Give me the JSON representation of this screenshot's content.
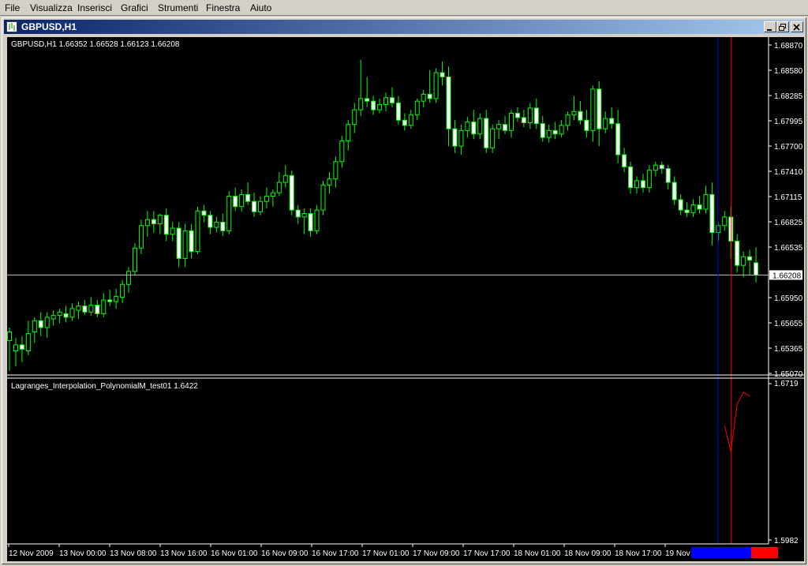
{
  "menu": [
    "File",
    "Visualizza",
    "Inserisci",
    "Grafici",
    "Strumenti",
    "Finestra",
    "Aiuto"
  ],
  "window": {
    "title": "GBPUSD,H1"
  },
  "main_chart": {
    "info": "GBPUSD,H1  1.66352 1.66528 1.66123 1.66208",
    "price_ticks": [
      "1.68870",
      "1.68580",
      "1.68285",
      "1.67995",
      "1.67700",
      "1.67410",
      "1.67115",
      "1.66825",
      "1.66535",
      "1.65950",
      "1.65655",
      "1.65365",
      "1.65070"
    ],
    "current_price": "1.66208",
    "ylim": [
      1.6507,
      1.6887
    ],
    "bull_color": "#00ff00",
    "bear_color": "#ffffff",
    "hline_color": "#c0c0c0"
  },
  "indicator": {
    "label": "Lagranges_Interpolation_PolynomialM_test01 1.6422",
    "top_value": "1.6719",
    "bottom_value": "1.5982",
    "line_color": "#ff0000"
  },
  "time_axis": {
    "labels": [
      "12 Nov 2009",
      "13 Nov 00:00",
      "13 Nov 08:00",
      "13 Nov 16:00",
      "16 Nov 01:00",
      "16 Nov 09:00",
      "16 Nov 17:00",
      "17 Nov 01:00",
      "17 Nov 09:00",
      "17 Nov 17:00",
      "18 Nov 01:00",
      "18 Nov 09:00",
      "18 Nov 17:00",
      "19 Nov"
    ],
    "blue_marker_color": "#0000ff",
    "red_marker_color": "#ff0000"
  },
  "chart_data": {
    "type": "candlestick",
    "ylim": [
      1.6507,
      1.6887
    ],
    "candles": [
      {
        "o": 1.6545,
        "h": 1.656,
        "l": 1.651,
        "c": 1.6555
      },
      {
        "o": 1.6533,
        "h": 1.6548,
        "l": 1.6515,
        "c": 1.654
      },
      {
        "o": 1.654,
        "h": 1.655,
        "l": 1.652,
        "c": 1.6535
      },
      {
        "o": 1.6533,
        "h": 1.6568,
        "l": 1.6528,
        "c": 1.6553
      },
      {
        "o": 1.6555,
        "h": 1.6572,
        "l": 1.6542,
        "c": 1.6568
      },
      {
        "o": 1.6568,
        "h": 1.6578,
        "l": 1.655,
        "c": 1.656
      },
      {
        "o": 1.656,
        "h": 1.6578,
        "l": 1.6548,
        "c": 1.6572
      },
      {
        "o": 1.657,
        "h": 1.658,
        "l": 1.6562,
        "c": 1.6574
      },
      {
        "o": 1.6574,
        "h": 1.6582,
        "l": 1.6565,
        "c": 1.6578
      },
      {
        "o": 1.6576,
        "h": 1.6585,
        "l": 1.6566,
        "c": 1.6572
      },
      {
        "o": 1.6572,
        "h": 1.6588,
        "l": 1.6568,
        "c": 1.6582
      },
      {
        "o": 1.658,
        "h": 1.659,
        "l": 1.657,
        "c": 1.6585
      },
      {
        "o": 1.6585,
        "h": 1.6592,
        "l": 1.6575,
        "c": 1.6578
      },
      {
        "o": 1.6578,
        "h": 1.6595,
        "l": 1.6574,
        "c": 1.6586
      },
      {
        "o": 1.6586,
        "h": 1.6592,
        "l": 1.6572,
        "c": 1.6576
      },
      {
        "o": 1.6576,
        "h": 1.66,
        "l": 1.6572,
        "c": 1.6592
      },
      {
        "o": 1.6592,
        "h": 1.6604,
        "l": 1.6585,
        "c": 1.659
      },
      {
        "o": 1.659,
        "h": 1.6605,
        "l": 1.6582,
        "c": 1.6596
      },
      {
        "o": 1.6595,
        "h": 1.6615,
        "l": 1.6588,
        "c": 1.661
      },
      {
        "o": 1.661,
        "h": 1.663,
        "l": 1.66,
        "c": 1.6625
      },
      {
        "o": 1.6625,
        "h": 1.6658,
        "l": 1.662,
        "c": 1.6652
      },
      {
        "o": 1.6652,
        "h": 1.6685,
        "l": 1.6645,
        "c": 1.6678
      },
      {
        "o": 1.6678,
        "h": 1.6695,
        "l": 1.6665,
        "c": 1.6685
      },
      {
        "o": 1.6685,
        "h": 1.6695,
        "l": 1.667,
        "c": 1.668
      },
      {
        "o": 1.668,
        "h": 1.6692,
        "l": 1.6668,
        "c": 1.669
      },
      {
        "o": 1.669,
        "h": 1.6698,
        "l": 1.666,
        "c": 1.6668
      },
      {
        "o": 1.6668,
        "h": 1.6682,
        "l": 1.666,
        "c": 1.6675
      },
      {
        "o": 1.6675,
        "h": 1.6682,
        "l": 1.663,
        "c": 1.664
      },
      {
        "o": 1.664,
        "h": 1.668,
        "l": 1.663,
        "c": 1.6672
      },
      {
        "o": 1.6672,
        "h": 1.668,
        "l": 1.664,
        "c": 1.6648
      },
      {
        "o": 1.6648,
        "h": 1.67,
        "l": 1.6645,
        "c": 1.6695
      },
      {
        "o": 1.6695,
        "h": 1.6702,
        "l": 1.6682,
        "c": 1.669
      },
      {
        "o": 1.669,
        "h": 1.6695,
        "l": 1.6668,
        "c": 1.6676
      },
      {
        "o": 1.6676,
        "h": 1.6688,
        "l": 1.667,
        "c": 1.6682
      },
      {
        "o": 1.6682,
        "h": 1.6692,
        "l": 1.6666,
        "c": 1.6672
      },
      {
        "o": 1.6672,
        "h": 1.6718,
        "l": 1.6668,
        "c": 1.6712
      },
      {
        "o": 1.6712,
        "h": 1.6722,
        "l": 1.6695,
        "c": 1.67
      },
      {
        "o": 1.67,
        "h": 1.672,
        "l": 1.6694,
        "c": 1.6714
      },
      {
        "o": 1.6714,
        "h": 1.6728,
        "l": 1.6702,
        "c": 1.6706
      },
      {
        "o": 1.6706,
        "h": 1.6716,
        "l": 1.6688,
        "c": 1.6694
      },
      {
        "o": 1.6694,
        "h": 1.6712,
        "l": 1.669,
        "c": 1.6706
      },
      {
        "o": 1.6706,
        "h": 1.6722,
        "l": 1.6698,
        "c": 1.6712
      },
      {
        "o": 1.6712,
        "h": 1.672,
        "l": 1.67,
        "c": 1.6716
      },
      {
        "o": 1.6716,
        "h": 1.674,
        "l": 1.6712,
        "c": 1.6728
      },
      {
        "o": 1.6728,
        "h": 1.6748,
        "l": 1.6722,
        "c": 1.6736
      },
      {
        "o": 1.6736,
        "h": 1.6742,
        "l": 1.669,
        "c": 1.6696
      },
      {
        "o": 1.6696,
        "h": 1.6702,
        "l": 1.668,
        "c": 1.6688
      },
      {
        "o": 1.6688,
        "h": 1.6698,
        "l": 1.6668,
        "c": 1.6692
      },
      {
        "o": 1.6692,
        "h": 1.6698,
        "l": 1.6665,
        "c": 1.6672
      },
      {
        "o": 1.6672,
        "h": 1.6702,
        "l": 1.6668,
        "c": 1.6696
      },
      {
        "o": 1.6696,
        "h": 1.673,
        "l": 1.669,
        "c": 1.6725
      },
      {
        "o": 1.6725,
        "h": 1.674,
        "l": 1.6715,
        "c": 1.6732
      },
      {
        "o": 1.6732,
        "h": 1.6758,
        "l": 1.6722,
        "c": 1.6752
      },
      {
        "o": 1.6752,
        "h": 1.6782,
        "l": 1.6745,
        "c": 1.6776
      },
      {
        "o": 1.6776,
        "h": 1.68,
        "l": 1.6765,
        "c": 1.6795
      },
      {
        "o": 1.6795,
        "h": 1.682,
        "l": 1.6785,
        "c": 1.6812
      },
      {
        "o": 1.6812,
        "h": 1.687,
        "l": 1.6805,
        "c": 1.6825
      },
      {
        "o": 1.6825,
        "h": 1.685,
        "l": 1.6815,
        "c": 1.6822
      },
      {
        "o": 1.6822,
        "h": 1.6828,
        "l": 1.6806,
        "c": 1.6812
      },
      {
        "o": 1.6812,
        "h": 1.6825,
        "l": 1.6808,
        "c": 1.6818
      },
      {
        "o": 1.6818,
        "h": 1.6832,
        "l": 1.681,
        "c": 1.6826
      },
      {
        "o": 1.6826,
        "h": 1.6838,
        "l": 1.6815,
        "c": 1.682
      },
      {
        "o": 1.682,
        "h": 1.6828,
        "l": 1.6795,
        "c": 1.68
      },
      {
        "o": 1.68,
        "h": 1.6808,
        "l": 1.6788,
        "c": 1.6794
      },
      {
        "o": 1.6794,
        "h": 1.6812,
        "l": 1.679,
        "c": 1.6806
      },
      {
        "o": 1.6806,
        "h": 1.6825,
        "l": 1.68,
        "c": 1.6822
      },
      {
        "o": 1.6822,
        "h": 1.6835,
        "l": 1.6815,
        "c": 1.683
      },
      {
        "o": 1.683,
        "h": 1.6858,
        "l": 1.682,
        "c": 1.6825
      },
      {
        "o": 1.6825,
        "h": 1.686,
        "l": 1.682,
        "c": 1.6855
      },
      {
        "o": 1.6855,
        "h": 1.6868,
        "l": 1.684,
        "c": 1.685
      },
      {
        "o": 1.685,
        "h": 1.6862,
        "l": 1.677,
        "c": 1.679
      },
      {
        "o": 1.679,
        "h": 1.68,
        "l": 1.6762,
        "c": 1.677
      },
      {
        "o": 1.677,
        "h": 1.6795,
        "l": 1.676,
        "c": 1.6788
      },
      {
        "o": 1.6788,
        "h": 1.6804,
        "l": 1.678,
        "c": 1.6798
      },
      {
        "o": 1.6798,
        "h": 1.6812,
        "l": 1.6778,
        "c": 1.6784
      },
      {
        "o": 1.6784,
        "h": 1.6808,
        "l": 1.6778,
        "c": 1.6802
      },
      {
        "o": 1.6802,
        "h": 1.6812,
        "l": 1.6762,
        "c": 1.6768
      },
      {
        "o": 1.6768,
        "h": 1.6795,
        "l": 1.6762,
        "c": 1.679
      },
      {
        "o": 1.679,
        "h": 1.68,
        "l": 1.6778,
        "c": 1.6795
      },
      {
        "o": 1.6795,
        "h": 1.6805,
        "l": 1.6784,
        "c": 1.6788
      },
      {
        "o": 1.6788,
        "h": 1.6812,
        "l": 1.678,
        "c": 1.6808
      },
      {
        "o": 1.6808,
        "h": 1.6815,
        "l": 1.6798,
        "c": 1.6803
      },
      {
        "o": 1.6803,
        "h": 1.6812,
        "l": 1.6792,
        "c": 1.6797
      },
      {
        "o": 1.6797,
        "h": 1.682,
        "l": 1.679,
        "c": 1.6814
      },
      {
        "o": 1.6814,
        "h": 1.6825,
        "l": 1.679,
        "c": 1.6796
      },
      {
        "o": 1.6796,
        "h": 1.6805,
        "l": 1.6775,
        "c": 1.678
      },
      {
        "o": 1.678,
        "h": 1.6795,
        "l": 1.6774,
        "c": 1.6788
      },
      {
        "o": 1.6788,
        "h": 1.6798,
        "l": 1.6778,
        "c": 1.6784
      },
      {
        "o": 1.6784,
        "h": 1.68,
        "l": 1.678,
        "c": 1.6794
      },
      {
        "o": 1.6794,
        "h": 1.681,
        "l": 1.6788,
        "c": 1.6806
      },
      {
        "o": 1.6806,
        "h": 1.6828,
        "l": 1.68,
        "c": 1.681
      },
      {
        "o": 1.681,
        "h": 1.6822,
        "l": 1.6795,
        "c": 1.68
      },
      {
        "o": 1.68,
        "h": 1.6812,
        "l": 1.678,
        "c": 1.6788
      },
      {
        "o": 1.6788,
        "h": 1.684,
        "l": 1.6775,
        "c": 1.6836
      },
      {
        "o": 1.6836,
        "h": 1.6845,
        "l": 1.677,
        "c": 1.679
      },
      {
        "o": 1.679,
        "h": 1.681,
        "l": 1.6785,
        "c": 1.6802
      },
      {
        "o": 1.6802,
        "h": 1.6815,
        "l": 1.679,
        "c": 1.6796
      },
      {
        "o": 1.6796,
        "h": 1.6812,
        "l": 1.675,
        "c": 1.676
      },
      {
        "o": 1.676,
        "h": 1.6768,
        "l": 1.674,
        "c": 1.6746
      },
      {
        "o": 1.6746,
        "h": 1.6752,
        "l": 1.6715,
        "c": 1.6722
      },
      {
        "o": 1.6722,
        "h": 1.6735,
        "l": 1.6715,
        "c": 1.673
      },
      {
        "o": 1.673,
        "h": 1.6738,
        "l": 1.6716,
        "c": 1.6722
      },
      {
        "o": 1.6722,
        "h": 1.6748,
        "l": 1.6716,
        "c": 1.6742
      },
      {
        "o": 1.6742,
        "h": 1.6752,
        "l": 1.6735,
        "c": 1.6748
      },
      {
        "o": 1.6748,
        "h": 1.6752,
        "l": 1.6738,
        "c": 1.6744
      },
      {
        "o": 1.6744,
        "h": 1.6748,
        "l": 1.672,
        "c": 1.6728
      },
      {
        "o": 1.6728,
        "h": 1.6735,
        "l": 1.6702,
        "c": 1.6708
      },
      {
        "o": 1.6708,
        "h": 1.6714,
        "l": 1.669,
        "c": 1.6696
      },
      {
        "o": 1.6696,
        "h": 1.6705,
        "l": 1.6688,
        "c": 1.6693
      },
      {
        "o": 1.6693,
        "h": 1.6708,
        "l": 1.6688,
        "c": 1.6702
      },
      {
        "o": 1.6702,
        "h": 1.6712,
        "l": 1.6692,
        "c": 1.6697
      },
      {
        "o": 1.6697,
        "h": 1.6724,
        "l": 1.6692,
        "c": 1.6714
      },
      {
        "o": 1.6714,
        "h": 1.6728,
        "l": 1.6655,
        "c": 1.667
      },
      {
        "o": 1.667,
        "h": 1.6682,
        "l": 1.666,
        "c": 1.6678
      },
      {
        "o": 1.6678,
        "h": 1.6695,
        "l": 1.6672,
        "c": 1.6688
      },
      {
        "o": 1.6688,
        "h": 1.67,
        "l": 1.664,
        "c": 1.666
      },
      {
        "o": 1.666,
        "h": 1.6668,
        "l": 1.6624,
        "c": 1.6632
      },
      {
        "o": 1.6632,
        "h": 1.6648,
        "l": 1.6618,
        "c": 1.6642
      },
      {
        "o": 1.6642,
        "h": 1.665,
        "l": 1.662,
        "c": 1.6638
      },
      {
        "o": 1.6635,
        "h": 1.6653,
        "l": 1.6612,
        "c": 1.6621
      }
    ],
    "indicator_line": [
      {
        "index": 114,
        "value": 1.652
      },
      {
        "index": 115,
        "value": 1.64
      },
      {
        "index": 116,
        "value": 1.6622
      },
      {
        "index": 117,
        "value": 1.6678
      },
      {
        "index": 118,
        "value": 1.666
      }
    ],
    "indicator_ylim": [
      1.5982,
      1.6719
    ],
    "blue_marker_index": 113,
    "red_marker_index": 115
  }
}
